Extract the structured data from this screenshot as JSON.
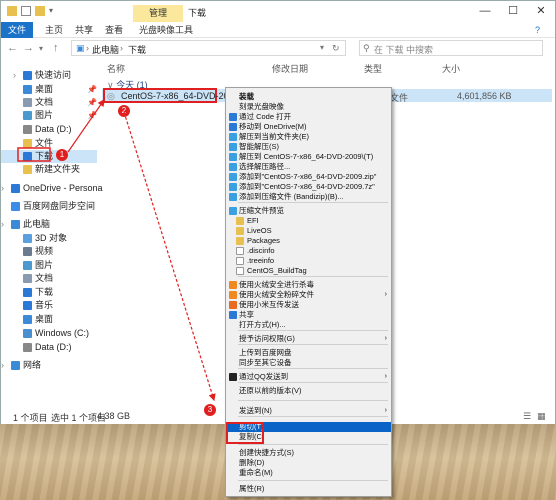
{
  "titlebar": {
    "manage_tab": "管理",
    "title": "下载",
    "min": "—",
    "max": "☐",
    "close": "✕"
  },
  "ribbon": {
    "tabs": [
      "文件",
      "主页",
      "共享",
      "查看",
      "光盘映像工具"
    ]
  },
  "address": {
    "path": [
      "此电脑",
      "下载"
    ],
    "search_placeholder": "在 下载 中搜索"
  },
  "sidebar": {
    "items": [
      {
        "label": "快速访问",
        "icon": "star-icon",
        "color": "#2b78d6"
      },
      {
        "label": "桌面",
        "icon": "desktop-icon",
        "color": "#3a8ad8"
      },
      {
        "label": "文档",
        "icon": "document-icon",
        "color": "#8a9ab0"
      },
      {
        "label": "图片",
        "icon": "picture-icon",
        "color": "#4a9ad0"
      },
      {
        "label": "Data (D:)",
        "icon": "drive-icon",
        "color": "#888"
      },
      {
        "label": "文件",
        "icon": "folder-icon",
        "color": "#e8c050"
      },
      {
        "label": "下载",
        "icon": "download-icon",
        "color": "#2b78d6"
      },
      {
        "label": "新建文件夹",
        "icon": "folder-icon",
        "color": "#e8c050"
      },
      {
        "label": "OneDrive - Persona",
        "icon": "cloud-icon",
        "color": "#2b78d6"
      },
      {
        "label": "百度网盘同步空间",
        "icon": "cloud-sync-icon",
        "color": "#3b8be8"
      },
      {
        "label": "此电脑",
        "icon": "computer-icon",
        "color": "#3a8ad8"
      },
      {
        "label": "3D 对象",
        "icon": "cube-icon",
        "color": "#5aa0e0"
      },
      {
        "label": "视频",
        "icon": "video-icon",
        "color": "#6a7a90"
      },
      {
        "label": "图片",
        "icon": "picture-icon",
        "color": "#4a9ad0"
      },
      {
        "label": "文档",
        "icon": "document-icon",
        "color": "#8a9ab0"
      },
      {
        "label": "下载",
        "icon": "download-icon",
        "color": "#2b78d6"
      },
      {
        "label": "音乐",
        "icon": "music-icon",
        "color": "#2b78d6"
      },
      {
        "label": "桌面",
        "icon": "desktop-icon",
        "color": "#3a8ad8"
      },
      {
        "label": "Windows (C:)",
        "icon": "drive-icon",
        "color": "#4a90d0"
      },
      {
        "label": "Data (D:)",
        "icon": "drive-icon",
        "color": "#888"
      },
      {
        "label": "网络",
        "icon": "network-icon",
        "color": "#3a8ad8"
      }
    ],
    "pin": "📌"
  },
  "columns": {
    "name": "名称",
    "modified": "修改日期",
    "type": "类型",
    "size": "大小"
  },
  "group": {
    "label": "今天 (1)"
  },
  "file": {
    "name": "CentOS-7-x86_64-DVD-2009.iso",
    "type": "文件",
    "size": "4,601,856 KB"
  },
  "status": {
    "count": "1 个项目",
    "selected": "选中 1 个项目",
    "size": "4.38 GB"
  },
  "menu": {
    "items": [
      {
        "label": "装载",
        "bold": true
      },
      {
        "label": "刻录光盘映像"
      },
      {
        "label": "通过 Code 打开",
        "icon": "vscode-icon",
        "color": "#2a7ad8"
      },
      {
        "label": "移动到 OneDrive(M)",
        "icon": "cloud-icon",
        "color": "#2b78d6"
      },
      {
        "label": "解压到当前文件夹(E)",
        "icon": "bandizip-icon",
        "color": "#3aa0e0"
      },
      {
        "label": "智能解压(S)",
        "icon": "bandizip-icon",
        "color": "#3aa0e0"
      },
      {
        "label": "解压到 CentOS-7-x86_64-DVD-2009\\(T)",
        "icon": "bandizip-icon",
        "color": "#3aa0e0"
      },
      {
        "label": "选择解压路径...",
        "icon": "bandizip-icon",
        "color": "#3aa0e0"
      },
      {
        "label": "添加到\"CentOS-7-x86_64-DVD-2009.zip\"",
        "icon": "bandizip-icon",
        "color": "#3aa0e0"
      },
      {
        "label": "添加到\"CentOS-7-x86_64-DVD-2009.7z\"",
        "icon": "bandizip-icon",
        "color": "#3aa0e0"
      },
      {
        "label": "添加到压缩文件 (Bandizip)(B)...",
        "icon": "bandizip-icon",
        "color": "#3aa0e0"
      },
      {
        "label": "压缩文件预览",
        "icon": "bandizip-icon",
        "color": "#3aa0e0"
      },
      {
        "label": "EFI",
        "icon": "folder-icon",
        "color": "#e8c050"
      },
      {
        "label": "LiveOS",
        "icon": "folder-icon",
        "color": "#e8c050"
      },
      {
        "label": "Packages",
        "icon": "folder-icon",
        "color": "#e8c050"
      },
      {
        "label": ".discinfo",
        "icon": "file-icon",
        "color": "#ffffff"
      },
      {
        "label": ".treeinfo",
        "icon": "file-icon",
        "color": "#ffffff"
      },
      {
        "label": "CentOS_BuildTag",
        "icon": "file-icon",
        "color": "#ffffff"
      },
      {
        "label": "使用火绒安全进行杀毒",
        "icon": "huorong-icon",
        "color": "#f08a20"
      },
      {
        "label": "使用火绒安全粉碎文件",
        "icon": "huorong-icon",
        "color": "#f08a20",
        "sub": true
      },
      {
        "label": "使用小米互传发送",
        "icon": "share-icon",
        "color": "#e86a20"
      },
      {
        "label": "共享",
        "icon": "share-icon",
        "color": "#2b78d6"
      },
      {
        "label": "打开方式(H)..."
      },
      {
        "label": "授予访问权限(G)",
        "sub": true
      },
      {
        "label": "上传到百度网盘"
      },
      {
        "label": "同步至其它设备"
      },
      {
        "label": "通过QQ发送到",
        "icon": "qq-icon",
        "color": "#222",
        "sub": true
      },
      {
        "label": "还原以前的版本(V)"
      },
      {
        "label": "发送到(N)",
        "sub": true
      },
      {
        "label": "剪切(T)",
        "highlight": true
      },
      {
        "label": "复制(C)"
      },
      {
        "label": "创建快捷方式(S)"
      },
      {
        "label": "删除(D)"
      },
      {
        "label": "重命名(M)"
      },
      {
        "label": "属性(R)"
      }
    ],
    "arrow": "›"
  },
  "badges": [
    "1",
    "2",
    "3"
  ],
  "accent_red": "#e02020",
  "accent_blue": "#0a64c8"
}
